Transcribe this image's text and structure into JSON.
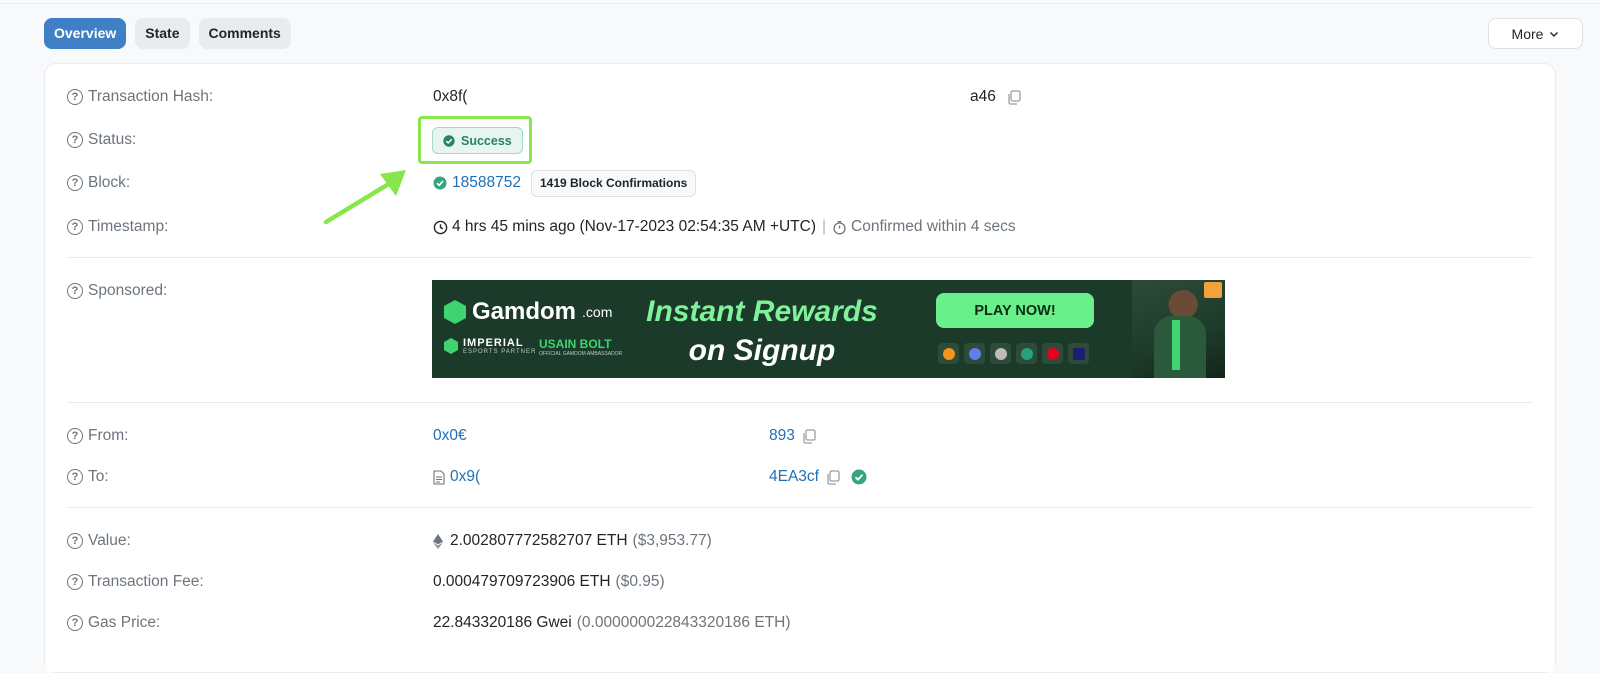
{
  "tabs": [
    {
      "label": "Overview",
      "active": true
    },
    {
      "label": "State",
      "active": false
    },
    {
      "label": "Comments",
      "active": false
    }
  ],
  "more_label": "More",
  "fields": {
    "tx_hash": {
      "label": "Transaction Hash:",
      "value_start": "0x8f(",
      "value_end": "a46"
    },
    "status": {
      "label": "Status:",
      "value": "Success"
    },
    "block": {
      "label": "Block:",
      "value": "18588752",
      "confirmations": "1419 Block Confirmations"
    },
    "timestamp": {
      "label": "Timestamp:",
      "value": "4 hrs 45 mins ago (Nov-17-2023 02:54:35 AM +UTC)",
      "separator": "|",
      "confirmed": "Confirmed within 4 secs"
    },
    "sponsored": {
      "label": "Sponsored:"
    },
    "from": {
      "label": "From:",
      "value_start": "0x0€",
      "value_end": "893"
    },
    "to": {
      "label": "To:",
      "value_start": "0x9(",
      "value_end": "4EA3cf"
    },
    "value": {
      "label": "Value:",
      "amount": "2.002807772582707 ETH",
      "usd": "($3,953.77)"
    },
    "fee": {
      "label": "Transaction Fee:",
      "amount": "0.000479709723906 ETH",
      "usd": "($0.95)"
    },
    "gas": {
      "label": "Gas Price:",
      "amount": "22.843320186 Gwei",
      "eth": "(0.000000022843320186 ETH)"
    }
  },
  "banner": {
    "brand": "Gamdom",
    "brand_suffix": ".com",
    "partner_line1": "IMPERIAL",
    "partner_line2": "ESPORTS PARTNER",
    "ambassador_line1": "USAIN BOLT",
    "ambassador_line2": "OFFICIAL GAMDOM AMBASSADOR",
    "headline_1": "Instant Rewards",
    "headline_2": "on Signup",
    "cta": "PLAY NOW!",
    "coin_colors": [
      "#f7931a",
      "#627eea",
      "#bfbbbb",
      "#26a17b",
      "#eb001b",
      "#1a1f71"
    ]
  },
  "colors": {
    "accent": "#3f7fc6",
    "link": "#1f6fb6",
    "success": "#278463",
    "highlight": "#86e64a"
  }
}
